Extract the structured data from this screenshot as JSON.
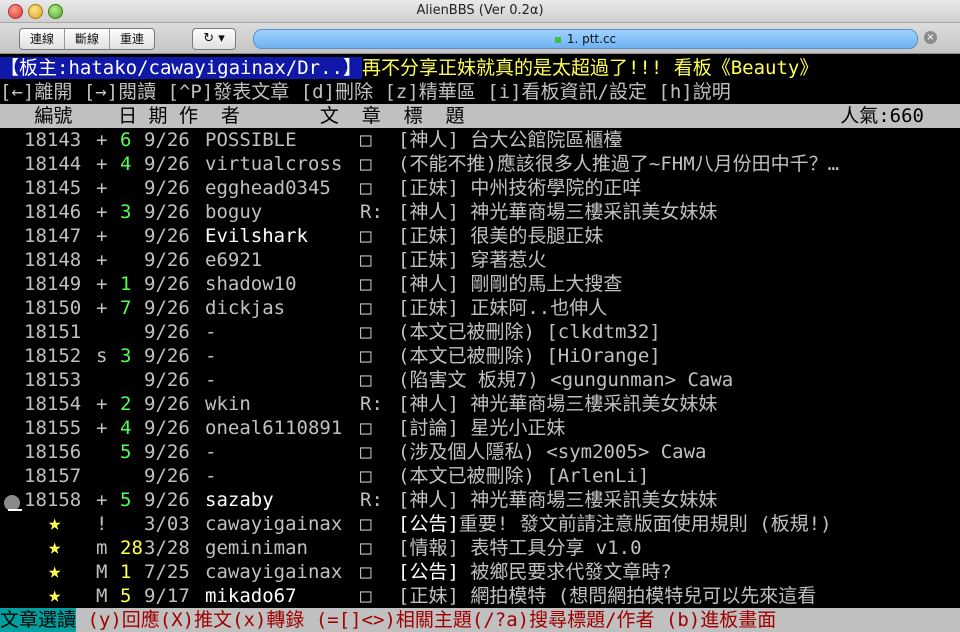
{
  "window": {
    "title": "AlienBBS (Ver 0.2α)"
  },
  "toolbar": {
    "connect": "連線",
    "disconnect": "斷線",
    "reconnect": "重連",
    "refresh": "↻ ▾",
    "tab_label": "1. ptt.cc",
    "tab_close": "×"
  },
  "terminal": {
    "header_board_info": "【板主:hatako/cawayigainax/Dr..】",
    "header_title": "再不分享正妹就真的是太超過了!!! 看板《Beauty》",
    "help_line": "[←]離開 [→]閱讀 [^P]發表文章 [d]刪除 [z]精華區 [i]看板資訊/設定 [h]說明",
    "column_header": "   編號    日 期 作  者       文  章  標  題",
    "popularity": "人氣:660",
    "rows": [
      {
        "num": "18143",
        "mark": "+",
        "rec": "6",
        "date": "9/26",
        "author": "POSSIBLE",
        "type": "□",
        "title": "[神人] 台大公館院區櫃檯"
      },
      {
        "num": "18144",
        "mark": "+",
        "rec": "4",
        "date": "9/26",
        "author": "virtualcross",
        "type": "□",
        "title": "(不能不推)應該很多人推過了~FHM八月份田中千？…"
      },
      {
        "num": "18145",
        "mark": "+",
        "rec": "",
        "date": "9/26",
        "author": "egghead0345",
        "type": "□",
        "title": "[正妹] 中州技術學院的正咩"
      },
      {
        "num": "18146",
        "mark": "+",
        "rec": "3",
        "date": "9/26",
        "author": "boguy",
        "type": "R:",
        "title": "[神人] 神光華商場三樓采訊美女妹妹"
      },
      {
        "num": "18147",
        "mark": "+",
        "rec": "",
        "date": "9/26",
        "author": "Evilshark",
        "type": "□",
        "title": "[正妹] 很美的長腿正妹"
      },
      {
        "num": "18148",
        "mark": "+",
        "rec": "",
        "date": "9/26",
        "author": "e6921",
        "type": "□",
        "title": "[正妹] 穿著惹火"
      },
      {
        "num": "18149",
        "mark": "+",
        "rec": "1",
        "date": "9/26",
        "author": "shadow10",
        "type": "□",
        "title": "[神人] 剛剛的馬上大搜查"
      },
      {
        "num": "18150",
        "mark": "+",
        "rec": "7",
        "date": "9/26",
        "author": "dickjas",
        "type": "□",
        "title": "[正妹] 正妹阿..也伸人"
      },
      {
        "num": "18151",
        "mark": "",
        "rec": "",
        "date": "9/26",
        "author": "-",
        "type": "□",
        "title": "(本文已被刪除) [clkdtm32]"
      },
      {
        "num": "18152",
        "mark": "s",
        "rec": "3",
        "date": "9/26",
        "author": "-",
        "type": "□",
        "title": "(本文已被刪除) [HiOrange]"
      },
      {
        "num": "18153",
        "mark": "",
        "rec": "",
        "date": "9/26",
        "author": "-",
        "type": "□",
        "title": "(陷害文 板規7) <gungunman> Cawa"
      },
      {
        "num": "18154",
        "mark": "+",
        "rec": "2",
        "date": "9/26",
        "author": "wkin",
        "type": "R:",
        "title": "[神人] 神光華商場三樓采訊美女妹妹"
      },
      {
        "num": "18155",
        "mark": "+",
        "rec": "4",
        "date": "9/26",
        "author": "oneal6110891",
        "type": "□",
        "title": "[討論] 星光小正妹"
      },
      {
        "num": "18156",
        "mark": "",
        "rec": "5",
        "date": "9/26",
        "author": "-",
        "type": "□",
        "title": "(涉及個人隱私) <sym2005> Cawa"
      },
      {
        "num": "18157",
        "mark": "",
        "rec": "",
        "date": "9/26",
        "author": "-",
        "type": "□",
        "title": "(本文已被刪除) [ArlenLi]"
      },
      {
        "num": "18158",
        "mark": "+",
        "rec": "5",
        "date": "9/26",
        "author": "sazaby",
        "type": "R:",
        "title": "[神人] 神光華商場三樓采訊美女妹妹"
      }
    ],
    "pinned": [
      {
        "mark": "!",
        "rec": "",
        "date": "3/03",
        "author": "cawayigainax",
        "type": "□",
        "tag": "[公告]",
        "title": "重要! 發文前請注意版面使用規則 (板規!)"
      },
      {
        "mark": "m",
        "rec": "28",
        "date": "3/28",
        "author": "geminiman",
        "type": "□",
        "tag": "",
        "title": "[情報] 表特工具分享 v1.0"
      },
      {
        "mark": "M",
        "rec": "1",
        "date": "7/25",
        "author": "cawayigainax",
        "type": "□",
        "tag": "[公告]",
        "title": " 被鄉民要求代發文章時?"
      },
      {
        "mark": "M",
        "rec": "5",
        "date": "9/17",
        "author": "mikado67",
        "type": "□",
        "tag": "",
        "title": "[正妹] 網拍模特 (想問網拍模特兒可以先來這看"
      }
    ],
    "footer_mode": "文章選讀",
    "footer_help": " (y)回應(X)推文(x)轉錄 (=[]<>)相關主題(/?a)搜尋標題/作者 (b)進板畫面"
  }
}
